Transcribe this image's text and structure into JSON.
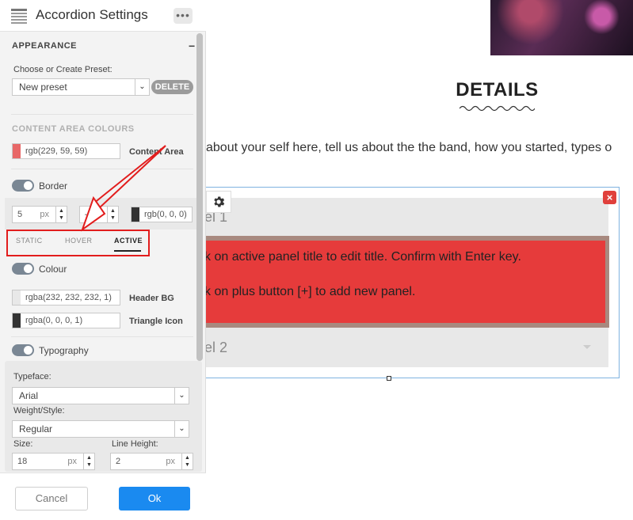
{
  "panel": {
    "title": "Accordion Settings",
    "more_label": "•••",
    "appearance": {
      "label": "APPEARANCE",
      "collapse_label": "−"
    },
    "preset": {
      "label": "Choose or Create Preset:",
      "value": "New preset",
      "delete_label": "DELETE"
    },
    "content_area": {
      "label": "CONTENT AREA COLOURS",
      "value": "rgb(229, 59, 59)",
      "color": "#e53b3b",
      "field_label": "Content Area"
    },
    "border": {
      "label": "Border",
      "width_value": "5",
      "width_unit": "px",
      "style_value": "—",
      "color_value": "rgb(0, 0, 0)",
      "color": "#000000"
    },
    "tabs": [
      {
        "label": "STATIC"
      },
      {
        "label": "HOVER"
      },
      {
        "label": "ACTIVE"
      }
    ],
    "colour": {
      "label": "Colour",
      "header_bg_value": "rgba(232, 232, 232, 1)",
      "header_bg_color": "#e8e8e8",
      "header_bg_label": "Header BG",
      "triangle_value": "rgba(0, 0, 0, 1)",
      "triangle_color": "#000000",
      "triangle_label": "Triangle Icon"
    },
    "typography": {
      "label": "Typography",
      "typeface_label": "Typeface:",
      "typeface_value": "Arial",
      "weight_label": "Weight/Style:",
      "weight_value": "Regular",
      "size_label": "Size:",
      "size_value": "18",
      "size_unit": "px",
      "line_height_label": "Line Height:",
      "line_height_value": "2",
      "line_height_unit": "px"
    },
    "footer": {
      "cancel_label": "Cancel",
      "ok_label": "Ok"
    }
  },
  "canvas": {
    "details_title": "DETAILS",
    "about_text": "about your self here, tell us about the the band, how you started, types o",
    "accordion": {
      "panel1_title": "el 1",
      "panel1_line1": "k on active panel title to edit title. Confirm with Enter key.",
      "panel1_line2": "k on plus button [+] to add new panel.",
      "panel2_title": "el 2",
      "close_label": "×"
    }
  }
}
